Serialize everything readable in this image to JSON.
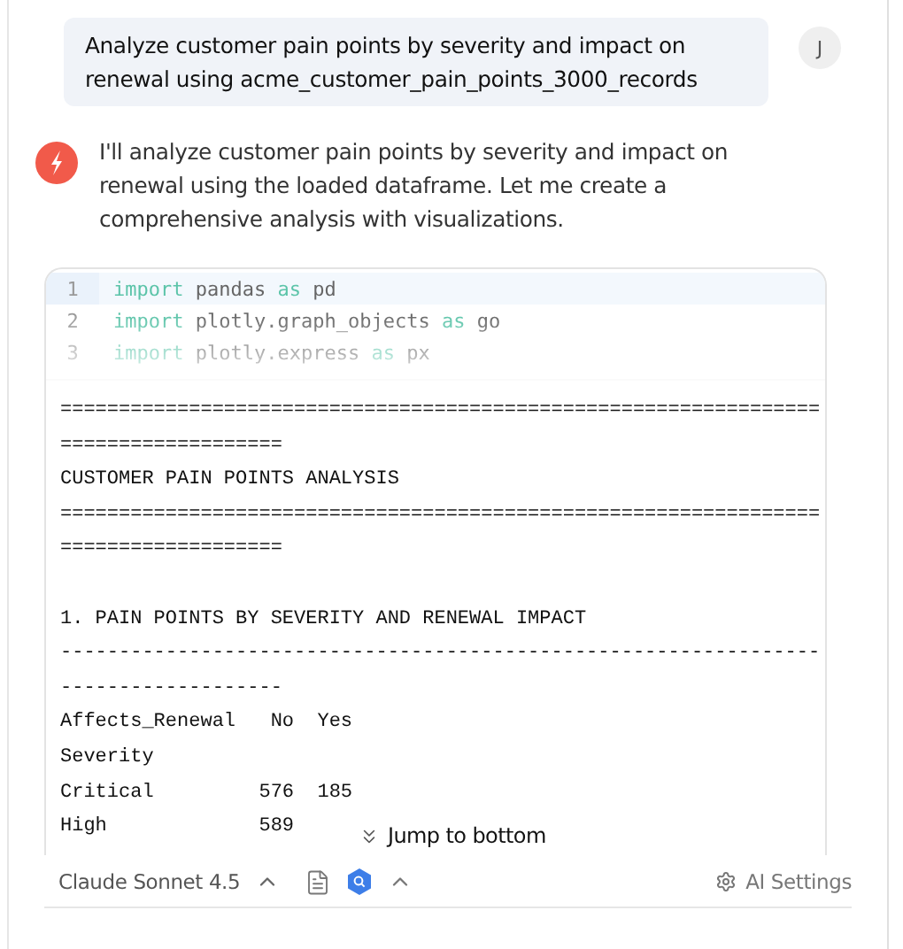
{
  "user_message": {
    "text": "Analyze customer pain points by severity and impact on renewal using acme_customer_pain_points_3000_records",
    "avatar": "J"
  },
  "assistant_message": {
    "text": "I'll analyze customer pain points by severity and impact on renewal using the loaded dataframe. Let me create a comprehensive analysis with visualizations."
  },
  "code_block": {
    "lines": [
      {
        "number": "1",
        "tokens": [
          {
            "kind": "keyword",
            "text": "import"
          },
          {
            "kind": "plain",
            "text": "pandas"
          },
          {
            "kind": "keyword",
            "text": "as"
          },
          {
            "kind": "plain",
            "text": "pd"
          }
        ],
        "active": true
      },
      {
        "number": "2",
        "tokens": [
          {
            "kind": "keyword",
            "text": "import"
          },
          {
            "kind": "plain",
            "text": "plotly.graph_objects"
          },
          {
            "kind": "keyword",
            "text": "as"
          },
          {
            "kind": "plain",
            "text": "go"
          }
        ],
        "active": false
      },
      {
        "number": "3",
        "tokens": [
          {
            "kind": "keyword",
            "text": "import"
          },
          {
            "kind": "plain",
            "text": "plotly.express"
          },
          {
            "kind": "keyword",
            "text": "as"
          },
          {
            "kind": "plain",
            "text": "px"
          }
        ],
        "active": false
      }
    ],
    "output_blocks": [
      [
        "=================================================================",
        "===================",
        "CUSTOMER PAIN POINTS ANALYSIS",
        "=================================================================",
        "==================="
      ],
      [
        "1. PAIN POINTS BY SEVERITY AND RENEWAL IMPACT",
        "-----------------------------------------------------------------",
        "-------------------",
        "Affects_Renewal   No  Yes",
        "Severity",
        "Critical         576  185",
        "High             589"
      ]
    ]
  },
  "jump_button": {
    "label": "Jump to bottom"
  },
  "footer": {
    "model": "Claude Sonnet 4.5",
    "settings": "AI Settings"
  }
}
